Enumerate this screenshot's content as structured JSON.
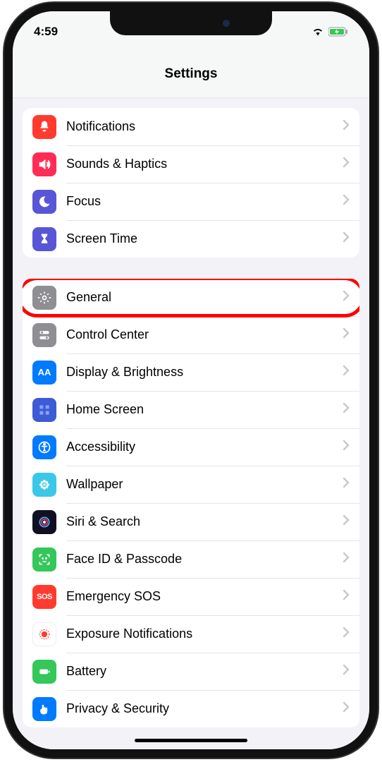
{
  "status": {
    "time": "4:59"
  },
  "header": {
    "title": "Settings"
  },
  "groups": [
    {
      "items": [
        {
          "id": "notifications",
          "label": "Notifications",
          "icon": "bell",
          "bg": "#ff3b30"
        },
        {
          "id": "sounds",
          "label": "Sounds & Haptics",
          "icon": "speaker",
          "bg": "#ff2d55"
        },
        {
          "id": "focus",
          "label": "Focus",
          "icon": "moon",
          "bg": "#5856d6"
        },
        {
          "id": "screentime",
          "label": "Screen Time",
          "icon": "hourglass",
          "bg": "#5856d6"
        }
      ]
    },
    {
      "items": [
        {
          "id": "general",
          "label": "General",
          "icon": "gear",
          "bg": "#8e8e93",
          "highlighted": true
        },
        {
          "id": "controlcenter",
          "label": "Control Center",
          "icon": "switches",
          "bg": "#8e8e93"
        },
        {
          "id": "display",
          "label": "Display & Brightness",
          "icon": "AA",
          "bg": "#007aff"
        },
        {
          "id": "homescreen",
          "label": "Home Screen",
          "icon": "grid",
          "bg": "#3c5bd4"
        },
        {
          "id": "accessibility",
          "label": "Accessibility",
          "icon": "person-circle",
          "bg": "#007aff"
        },
        {
          "id": "wallpaper",
          "label": "Wallpaper",
          "icon": "flower",
          "bg": "#39c8e8"
        },
        {
          "id": "siri",
          "label": "Siri & Search",
          "icon": "siri",
          "bg": "#101022"
        },
        {
          "id": "faceid",
          "label": "Face ID & Passcode",
          "icon": "faceid",
          "bg": "#34c759"
        },
        {
          "id": "sos",
          "label": "Emergency SOS",
          "icon": "SOS",
          "bg": "#ff3b30"
        },
        {
          "id": "exposure",
          "label": "Exposure Notifications",
          "icon": "exposure",
          "bg": "#ffffff"
        },
        {
          "id": "battery",
          "label": "Battery",
          "icon": "battery",
          "bg": "#34c759"
        },
        {
          "id": "privacy",
          "label": "Privacy & Security",
          "icon": "hand",
          "bg": "#007aff"
        }
      ]
    }
  ]
}
